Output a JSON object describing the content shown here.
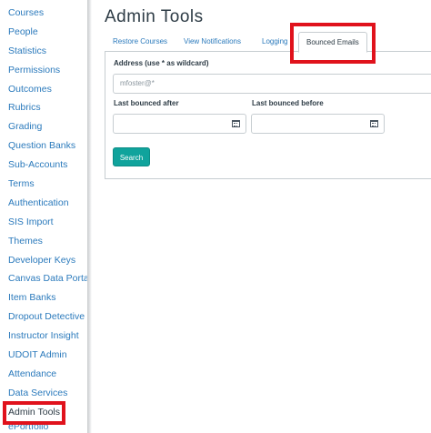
{
  "sidebar": {
    "items": [
      {
        "label": "Courses"
      },
      {
        "label": "People"
      },
      {
        "label": "Statistics"
      },
      {
        "label": "Permissions"
      },
      {
        "label": "Outcomes"
      },
      {
        "label": "Rubrics"
      },
      {
        "label": "Grading"
      },
      {
        "label": "Question Banks"
      },
      {
        "label": "Sub-Accounts"
      },
      {
        "label": "Terms"
      },
      {
        "label": "Authentication"
      },
      {
        "label": "SIS Import"
      },
      {
        "label": "Themes"
      },
      {
        "label": "Developer Keys"
      },
      {
        "label": "Canvas Data Portal"
      },
      {
        "label": "Item Banks"
      },
      {
        "label": "Dropout Detective"
      },
      {
        "label": "Instructor Insight"
      },
      {
        "label": "UDOIT Admin"
      },
      {
        "label": "Attendance"
      },
      {
        "label": "Data Services"
      },
      {
        "label": "Admin Tools"
      },
      {
        "label": "ePortfolio"
      }
    ],
    "active": "Admin Tools"
  },
  "main": {
    "title": "Admin Tools",
    "tabs": [
      {
        "label": "Restore Courses"
      },
      {
        "label": "View Notifications"
      },
      {
        "label": "Logging"
      },
      {
        "label": "Bounced Emails"
      }
    ],
    "active_tab": "Bounced Emails",
    "form": {
      "address_label": "Address (use * as wildcard)",
      "address_placeholder": "mfoster@*",
      "after_label": "Last bounced after",
      "before_label": "Last bounced before",
      "search_label": "Search"
    }
  },
  "colors": {
    "link": "#2b7abc",
    "text": "#2d3b45",
    "highlight": "#e0121c",
    "button": "#10a39c"
  },
  "icons": [
    "calendar-icon"
  ]
}
